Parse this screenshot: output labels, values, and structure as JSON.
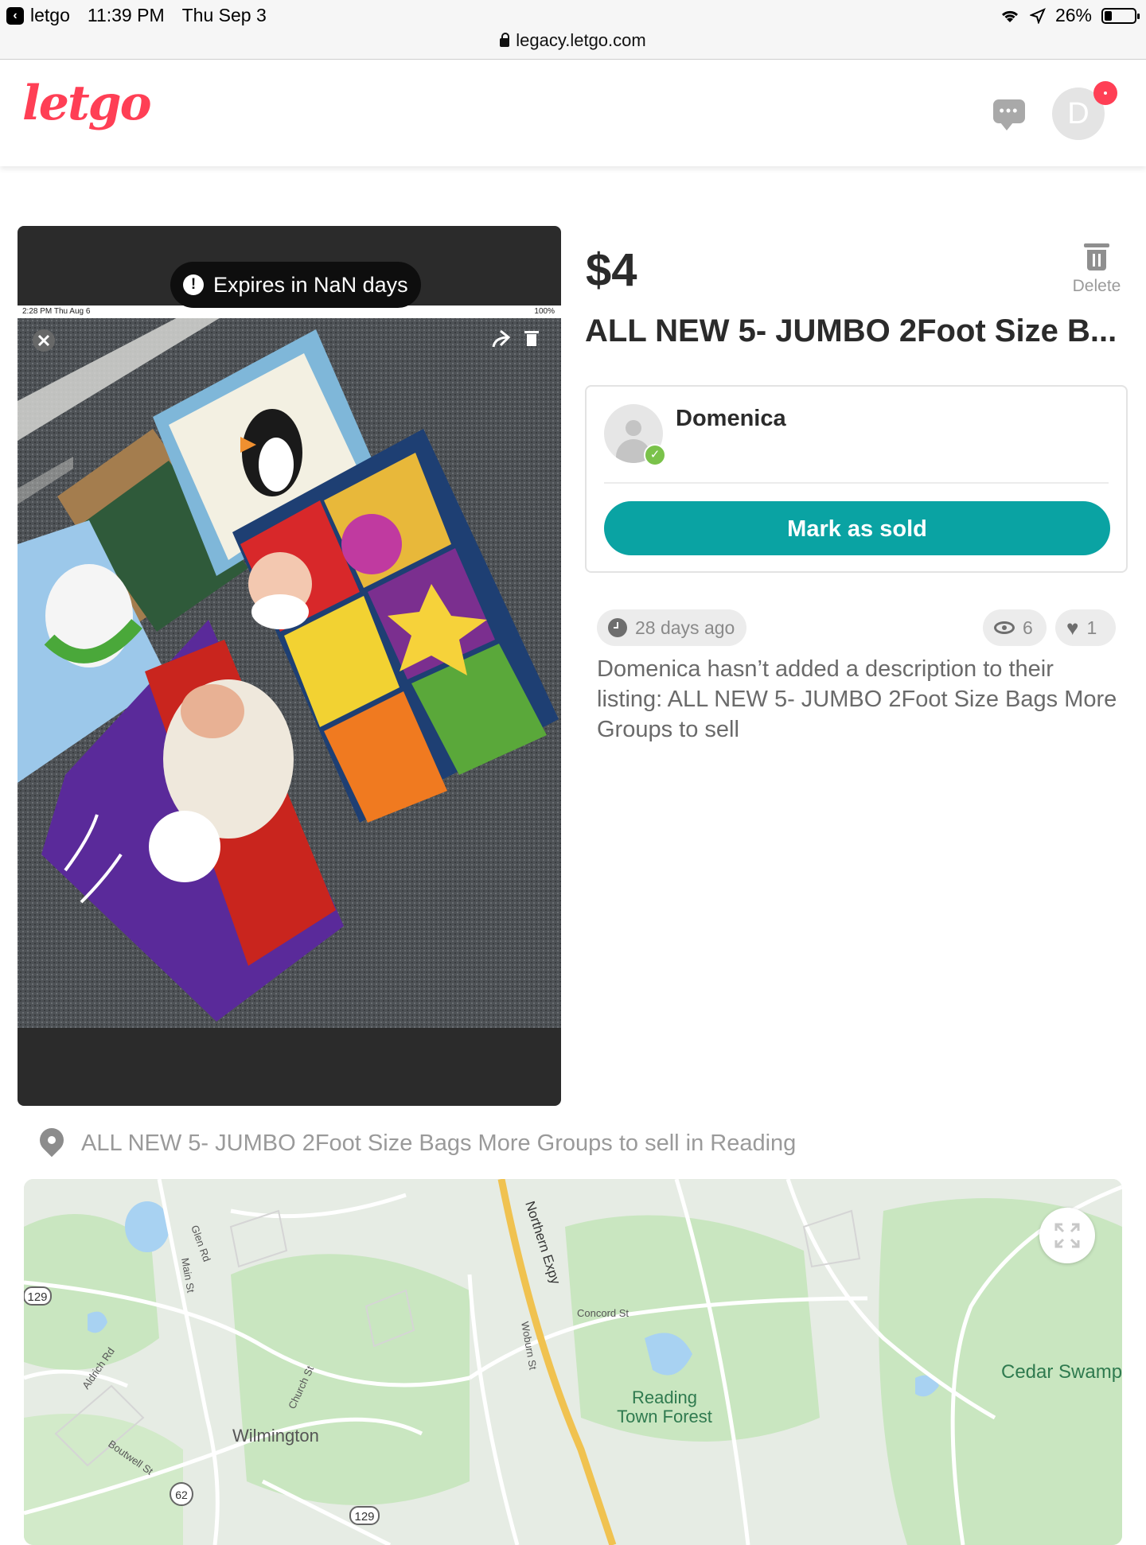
{
  "statusbar": {
    "back_app": "letgo",
    "time": "11:39 PM",
    "date": "Thu Sep 3",
    "battery": "26%",
    "battery_level": 0.26,
    "url": "legacy.letgo.com"
  },
  "header": {
    "logo": "letgo",
    "avatar_initial": "D",
    "icons": [
      "chat-icon",
      "notification-dot"
    ]
  },
  "viewer": {
    "expires_label": "Expires in NaN days",
    "screenshot_time": "2:28 PM   Thu Aug 6",
    "screenshot_battery": "100%"
  },
  "listing": {
    "price": "$4",
    "delete_label": "Delete",
    "title": "ALL NEW 5- JUMBO 2Foot Size B...",
    "seller_name": "Domenica",
    "mark_sold_label": "Mark as sold",
    "posted": "28 days ago",
    "views": "6",
    "favorites": "1",
    "description": "Domenica hasn’t added a description to their listing: ALL NEW 5-    JUMBO 2Foot Size Bags More Groups to sell"
  },
  "location": {
    "text": "ALL NEW 5- JUMBO 2Foot Size Bags More Groups to sell in Reading"
  },
  "map": {
    "labels": {
      "northern_expy": "Northern Expy",
      "concord_st": "Concord St",
      "glen_rd": "Glen Rd",
      "main_st": "Main St",
      "woburn_st": "Woburn St",
      "church_st": "Church St",
      "aldrich_rd": "Aldrich Rd",
      "boutwell_st": "Boutwell St",
      "wilmington": "Wilmington",
      "reading_forest_1": "Reading",
      "reading_forest_2": "Town Forest",
      "cedar_swamp": "Cedar Swamp",
      "route_129_a": "129",
      "route_129_b": "129",
      "route_62": "62"
    },
    "colors": {
      "land": "#e6ece4",
      "park": "#c9e6c0",
      "water": "#a8d2f2",
      "highway": "#f0c250",
      "road": "#ffffff"
    }
  }
}
